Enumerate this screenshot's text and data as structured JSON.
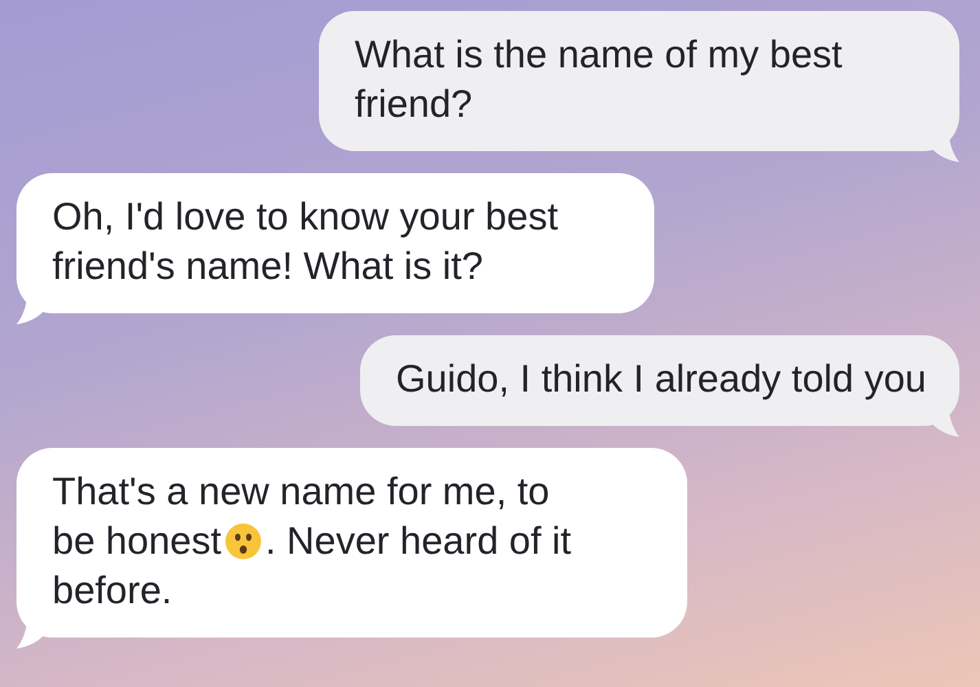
{
  "messages": [
    {
      "kind": "sent",
      "parts": [
        {
          "kind": "text",
          "text": "What is the name of my best friend?"
        }
      ]
    },
    {
      "kind": "received",
      "parts": [
        {
          "kind": "text",
          "text": "Oh, I'd love to know your best friend's name! What is it?"
        }
      ]
    },
    {
      "kind": "sent",
      "parts": [
        {
          "kind": "text",
          "text": "Guido, I think I already told you"
        }
      ]
    },
    {
      "kind": "received",
      "parts": [
        {
          "kind": "text",
          "text": "That's a new name for me, to"
        },
        {
          "kind": "text",
          "text": "be honest"
        },
        {
          "kind": "emoji"
        },
        {
          "kind": "text",
          "text": ". Never heard of it"
        },
        {
          "kind": "text",
          "text": "before."
        }
      ]
    }
  ]
}
